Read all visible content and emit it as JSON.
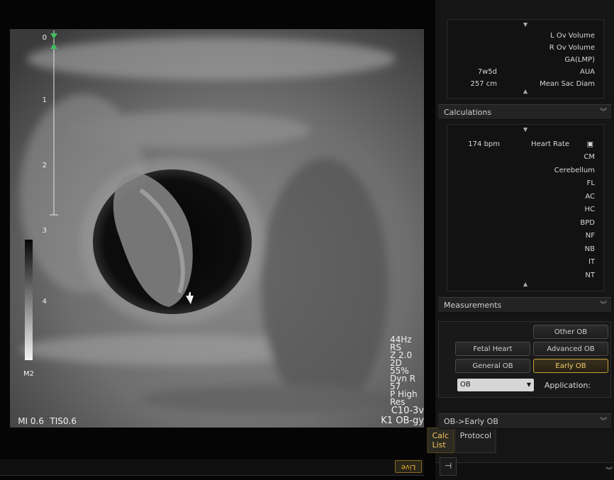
{
  "overlay": {
    "tis": "TIS0.6",
    "mi": "MI 0.6",
    "preset": "K1 OB-gy",
    "probe": "C10-3v",
    "params": [
      "44Hz",
      "RS",
      "Z 2.0",
      "2D",
      "55%",
      "Dyn R 57",
      "P High",
      "Res"
    ],
    "map_label": "M2",
    "depth_ticks": [
      "0",
      "1",
      "2",
      "3",
      "4"
    ]
  },
  "statusbar": {
    "live": "Live"
  },
  "panel": {
    "tabs": [
      "Calc List",
      "Protocol"
    ],
    "section_ob": "OB->Early OB",
    "application_label": "Application:",
    "application_value": "OB",
    "app_buttons": [
      "Early OB",
      "General OB",
      "Advanced OB",
      "Fetal Heart",
      "Other OB"
    ],
    "measurements_label": "Measurements",
    "measurements": [
      "NT",
      "IT",
      "NB",
      "NF",
      "BPD",
      "HC",
      "AC",
      "FL",
      "Cerebellum",
      "CM",
      "Heart Rate"
    ],
    "heart_rate_value": "174 bpm",
    "calculations_label": "Calculations",
    "calculations": [
      {
        "name": "Mean Sac Diam",
        "value": "257 cm"
      },
      {
        "name": "AUA",
        "value": "7w5d"
      },
      {
        "name": "GA(LMP)",
        "value": ""
      },
      {
        "name": "R Ov Volume",
        "value": ""
      },
      {
        "name": "L Ov Volume",
        "value": ""
      }
    ]
  },
  "colors": {
    "accent": "#f0c65a",
    "live": "#f0b33a"
  }
}
